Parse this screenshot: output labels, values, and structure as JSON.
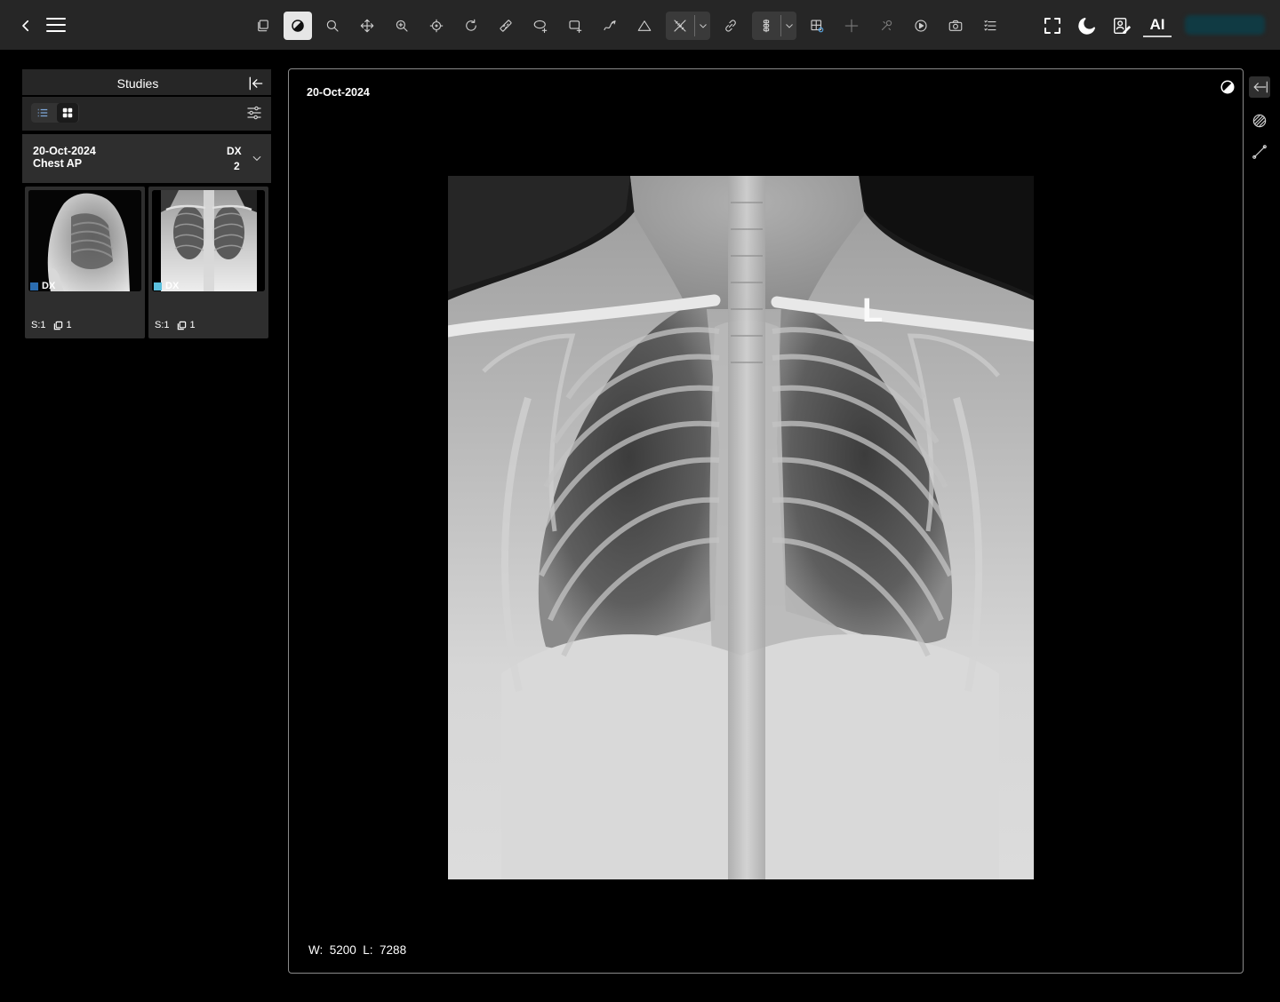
{
  "toolbar": {
    "left": [
      {
        "name": "back-icon"
      },
      {
        "name": "menu-icon"
      }
    ],
    "tools": [
      {
        "name": "layers-icon"
      },
      {
        "name": "window-level-icon",
        "active": true
      },
      {
        "name": "search-icon"
      },
      {
        "name": "pan-icon"
      },
      {
        "name": "zoom-in-icon"
      },
      {
        "name": "crosshair-icon"
      },
      {
        "name": "rotate-icon"
      },
      {
        "name": "ruler-icon"
      },
      {
        "name": "ellipse-roi-icon"
      },
      {
        "name": "rectangle-roi-icon"
      },
      {
        "name": "freehand-icon"
      },
      {
        "name": "angle-icon"
      },
      {
        "name": "annotation-split-icon"
      },
      {
        "name": "link-icon"
      },
      {
        "name": "spine-label-icon"
      },
      {
        "name": "mpr-icon"
      },
      {
        "name": "reference-lines-icon"
      },
      {
        "name": "probe-icon"
      },
      {
        "name": "cine-play-icon"
      },
      {
        "name": "camera-icon"
      },
      {
        "name": "list-icon"
      }
    ],
    "right": [
      {
        "name": "fullscreen-icon"
      },
      {
        "name": "dark-mode-icon"
      },
      {
        "name": "report-icon"
      }
    ],
    "ai_label": "AI"
  },
  "studies_panel": {
    "title": "Studies",
    "study": {
      "date": "20-Oct-2024",
      "description": "Chest AP",
      "modality": "DX",
      "series_count": "2"
    },
    "thumbnails": [
      {
        "modality": "DX",
        "series": "S:1",
        "instances": "1",
        "color": "#2b6cb0",
        "view": "lateral"
      },
      {
        "modality": "DX",
        "series": "S:1",
        "instances": "1",
        "color": "#5bc0de",
        "view": "ap"
      }
    ]
  },
  "viewport": {
    "date": "20-Oct-2024",
    "window_level": "W:  5200  L:  7288",
    "marker": "L"
  }
}
